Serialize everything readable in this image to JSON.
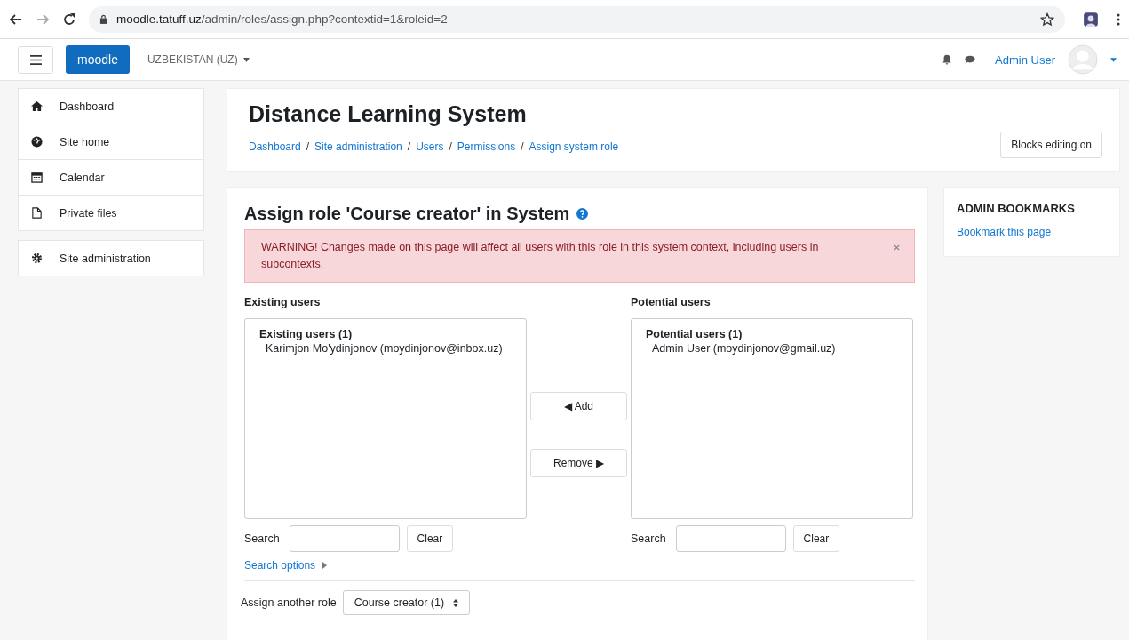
{
  "browser": {
    "url_host": "moodle.tatuff.uz",
    "url_path": "/admin/roles/assign.php?contextid=1&roleid=2"
  },
  "navbar": {
    "brand": "moodle",
    "language": "UZBEKISTAN (UZ)",
    "user": "Admin User"
  },
  "sidebar": {
    "groups": [
      [
        {
          "label": "Dashboard"
        },
        {
          "label": "Site home"
        },
        {
          "label": "Calendar"
        },
        {
          "label": "Private files"
        }
      ],
      [
        {
          "label": "Site administration"
        }
      ]
    ]
  },
  "header": {
    "title": "Distance Learning System",
    "breadcrumbs": [
      "Dashboard",
      "Site administration",
      "Users",
      "Permissions",
      "Assign system role"
    ],
    "separators": [
      "/",
      "/",
      "/",
      "/"
    ],
    "button": "Blocks editing on"
  },
  "main": {
    "heading": "Assign role 'Course creator' in System",
    "alert": "WARNING! Changes made on this page will affect all users with this role in this system context, including users in subcontexts.",
    "existing": {
      "label": "Existing users",
      "group": "Existing users (1)",
      "users": [
        "Karimjon Mo'ydinjonov (moydinjonov@inbox.uz)"
      ],
      "search_label": "Search",
      "clear_button": "Clear"
    },
    "potential": {
      "label": "Potential users",
      "group": "Potential users (1)",
      "users": [
        "Admin User (moydinjonov@gmail.uz)"
      ],
      "search_label": "Search",
      "clear_button": "Clear"
    },
    "add_button": "◀ Add",
    "remove_button": "Remove ▶",
    "search_options": "Search options",
    "another_role_label": "Assign another role",
    "another_role_value": "Course creator (1)"
  },
  "bookmarks": {
    "title": "ADMIN BOOKMARKS",
    "link": "Bookmark this page"
  }
}
